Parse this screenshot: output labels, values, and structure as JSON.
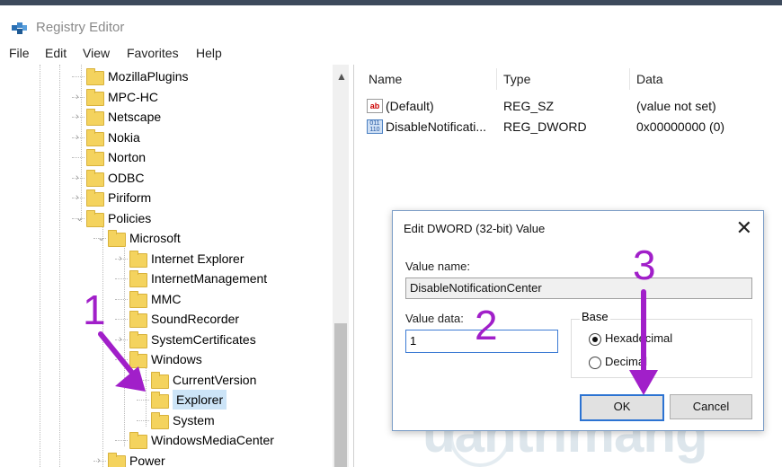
{
  "window": {
    "title": "Registry Editor"
  },
  "menu": [
    "File",
    "Edit",
    "View",
    "Favorites",
    "Help"
  ],
  "tree": [
    {
      "label": "MozillaPlugins",
      "expander": ""
    },
    {
      "label": "MPC-HC",
      "expander": ">"
    },
    {
      "label": "Netscape",
      "expander": ">"
    },
    {
      "label": "Nokia",
      "expander": ">"
    },
    {
      "label": "Norton",
      "expander": ""
    },
    {
      "label": "ODBC",
      "expander": ">"
    },
    {
      "label": "Piriform",
      "expander": ">"
    },
    {
      "label": "Policies",
      "expander": "v"
    },
    {
      "label": "Microsoft",
      "expander": "v"
    },
    {
      "label": "Internet Explorer",
      "expander": ">"
    },
    {
      "label": "InternetManagement",
      "expander": ""
    },
    {
      "label": "MMC",
      "expander": ""
    },
    {
      "label": "SoundRecorder",
      "expander": ""
    },
    {
      "label": "SystemCertificates",
      "expander": ">"
    },
    {
      "label": "Windows",
      "expander": "v"
    },
    {
      "label": "CurrentVersion",
      "expander": ""
    },
    {
      "label": "Explorer",
      "expander": ""
    },
    {
      "label": "System",
      "expander": ""
    },
    {
      "label": "WindowsMediaCenter",
      "expander": ""
    },
    {
      "label": "Power",
      "expander": ">"
    }
  ],
  "list": {
    "columns": [
      "Name",
      "Type",
      "Data"
    ],
    "rows": [
      {
        "icon": "string-value-icon",
        "icon_text": "ab",
        "name": "(Default)",
        "type": "REG_SZ",
        "data": "(value not set)"
      },
      {
        "icon": "binary-value-icon",
        "icon_text": "011 110",
        "name": "DisableNotificati...",
        "type": "REG_DWORD",
        "data": "0x00000000 (0)"
      }
    ]
  },
  "dialog": {
    "title": "Edit DWORD (32-bit) Value",
    "close": "✕",
    "value_name_label": "Value name:",
    "value_name": "DisableNotificationCenter",
    "value_data_label": "Value data:",
    "value_data": "1",
    "base_label": "Base",
    "base_options": [
      "Hexadecimal",
      "Decimal"
    ],
    "base_selected": "Hexadecimal",
    "ok_label": "OK",
    "cancel_label": "Cancel"
  },
  "annotations": [
    "1",
    "2",
    "3"
  ],
  "watermark": "uantrimang",
  "colors": {
    "annotation": "#a11fc9",
    "folder": "#f4d35e",
    "selection": "#cce4f7",
    "dialog_border": "#7a9cc6"
  }
}
